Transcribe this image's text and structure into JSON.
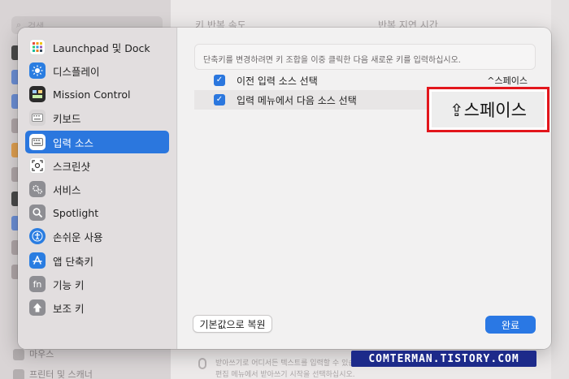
{
  "background": {
    "search_placeholder": "검색",
    "header_left": "키 반복 속도",
    "header_right": "반복 지연 시간",
    "sidebar_items": [
      "마우스",
      "프린터 및 스캐너"
    ],
    "bottom_text": [
      "받아쓰기로 어디서든 텍스트를 입력할 수 있습니다.",
      "편집 메뉴에서 받아쓰기 시작을 선택하십시오."
    ]
  },
  "dialog": {
    "sidebar": [
      {
        "label": "Launchpad 및 Dock",
        "icon": "grid-icon",
        "color": "#ffffff"
      },
      {
        "label": "디스플레이",
        "icon": "sun-icon",
        "color": "#2a7de1"
      },
      {
        "label": "Mission Control",
        "icon": "windows-icon",
        "color": "#2b2b2b"
      },
      {
        "label": "키보드",
        "icon": "keyboard-icon",
        "color": "#d7d4d5"
      },
      {
        "label": "입력 소스",
        "icon": "keyboard-icon",
        "color": "#ffffff",
        "selected": true
      },
      {
        "label": "스크린샷",
        "icon": "camera-icon",
        "color": "#ffffff"
      },
      {
        "label": "서비스",
        "icon": "gear-icon",
        "color": "#8e8e93"
      },
      {
        "label": "Spotlight",
        "icon": "magnifier-icon",
        "color": "#8e8e93"
      },
      {
        "label": "손쉬운 사용",
        "icon": "accessibility-icon",
        "color": "#2a7de1"
      },
      {
        "label": "앱 단축키",
        "icon": "app-store-icon",
        "color": "#2a7de1"
      },
      {
        "label": "기능 키",
        "icon": "fn-icon",
        "color": "#8e8e93"
      },
      {
        "label": "보조 키",
        "icon": "arrow-up-icon",
        "color": "#8e8e93"
      }
    ],
    "hint": "단축키를 변경하려면 키 조합을 이중 클릭한 다음 새로운 키를 입력하십시오.",
    "shortcuts": [
      {
        "label": "이전 입력 소스 선택",
        "shortcut": "^스페이스",
        "checked": true
      },
      {
        "label": "입력 메뉴에서 다음 소스 선택",
        "shortcut": "",
        "checked": true
      }
    ],
    "restore_button": "기본값으로 복원",
    "done_button": "완료"
  },
  "callout_text": "⇪스페이스",
  "watermark": "COMTERMAN.TISTORY.COM",
  "colors": {
    "accent": "#2b77de",
    "callout_border": "#e2161c",
    "watermark_bg": "#1d2a8a"
  }
}
